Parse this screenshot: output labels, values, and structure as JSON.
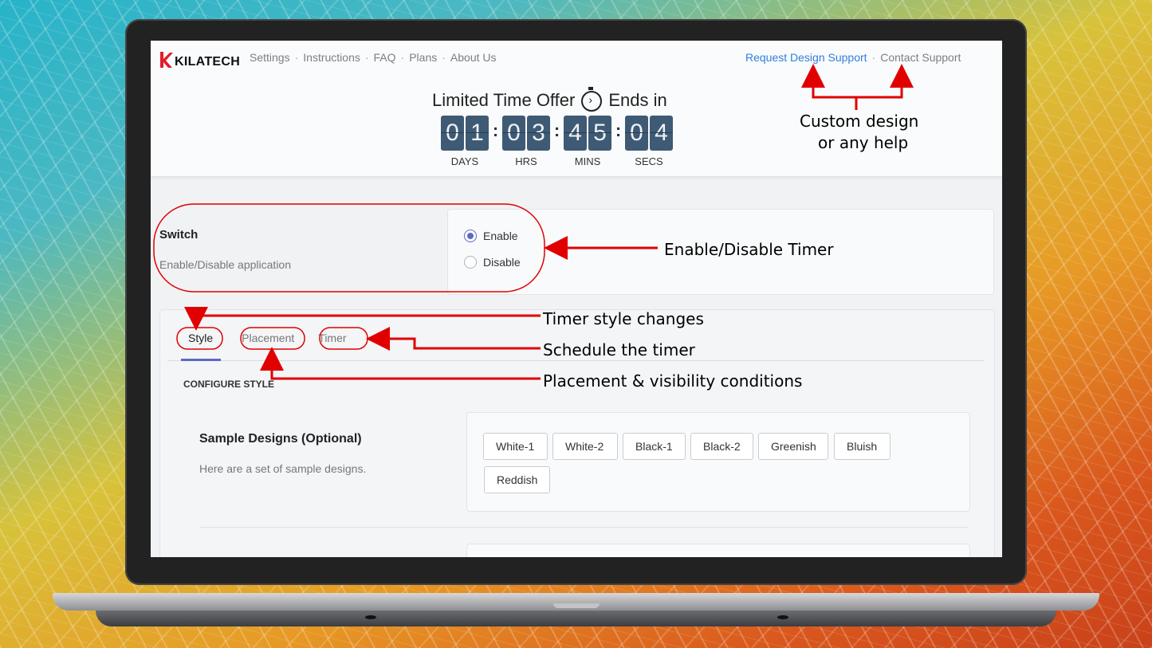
{
  "app": {
    "brand": "KILATECH",
    "nav": [
      "Settings",
      "Instructions",
      "FAQ",
      "Plans",
      "About Us"
    ],
    "nav_separator": "·",
    "support": {
      "request": "Request Design Support",
      "contact": "Contact Support"
    }
  },
  "offer": {
    "text_before": "Limited Time Offer",
    "text_after": "Ends in",
    "countdown": [
      {
        "digits": [
          "0",
          "1"
        ],
        "label": "DAYS"
      },
      {
        "digits": [
          "0",
          "3"
        ],
        "label": "HRS"
      },
      {
        "digits": [
          "4",
          "5"
        ],
        "label": "MINS"
      },
      {
        "digits": [
          "0",
          "4"
        ],
        "label": "SECS"
      }
    ],
    "colon": ":"
  },
  "switch": {
    "title": "Switch",
    "description": "Enable/Disable application",
    "options": [
      {
        "label": "Enable",
        "checked": true
      },
      {
        "label": "Disable",
        "checked": false
      }
    ]
  },
  "tabs": [
    {
      "label": "Style",
      "active": true
    },
    {
      "label": "Placement",
      "active": false
    },
    {
      "label": "Timer",
      "active": false
    }
  ],
  "configure_heading": "CONFIGURE STYLE",
  "sample_designs": {
    "title": "Sample Designs (Optional)",
    "description": "Here are a set of sample designs.",
    "buttons": [
      "White-1",
      "White-2",
      "Black-1",
      "Black-2",
      "Greenish",
      "Bluish",
      "Reddish"
    ]
  },
  "annotations": {
    "support_line1": "Custom design",
    "support_line2": "or any help",
    "switch": "Enable/Disable Timer",
    "style": "Timer style changes",
    "timer": "Schedule the timer",
    "placement": "Placement & visibility conditions"
  },
  "colors": {
    "accent": "#5c6ac4",
    "link": "#2f7fe0",
    "countdown_tile": "#3f5a74",
    "annotation": "#e00000"
  }
}
